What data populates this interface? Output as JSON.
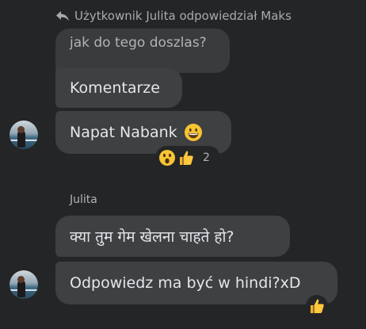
{
  "reply_header": {
    "text": "Użytkownik Julita odpowiedział Maks"
  },
  "messages": [
    {
      "quoted_text": "jak do tego doszlas?",
      "text": "Komentarze"
    },
    {
      "text": "Napat Nabank",
      "emoji": "grinning-face",
      "reactions": {
        "icons": [
          "wow-face-icon",
          "thumbs-up-icon"
        ],
        "count": "2"
      }
    }
  ],
  "sender": {
    "name": "Julita"
  },
  "messages_2": [
    {
      "text": "क्या तुम गेम खेलना चाहते हो?"
    },
    {
      "text": "Odpowiedz ma być w hindi?xD",
      "reaction_icon": "thumbs-up-icon"
    }
  ],
  "colors": {
    "background": "#242526",
    "bubble": "#3e4042",
    "quoted_bubble": "#3a3b3c",
    "text": "#e4e6eb",
    "muted_text": "#b0b3b8",
    "emoji_yellow": "#f7c532",
    "like_yellow": "#ffc83d"
  }
}
